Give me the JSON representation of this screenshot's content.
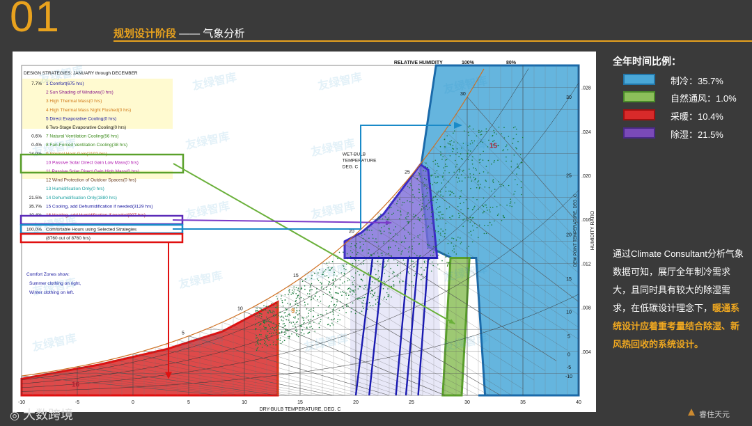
{
  "header": {
    "number": "01",
    "title": "规划设计阶段",
    "subtitle": " —— 气象分析"
  },
  "legend": {
    "title": "全年时间比例：",
    "items": [
      {
        "label": "制冷：35.7%",
        "fill": "#4aa8d8",
        "border": "#2277aa"
      },
      {
        "label": "自然通风：1.0%",
        "fill": "#8cbf5a",
        "border": "#4a8a2a"
      },
      {
        "label": "采暖：10.4%",
        "fill": "#d82a2a",
        "border": "#a01010"
      },
      {
        "label": "除湿：21.5%",
        "fill": "#7a4ab8",
        "border": "#4a2a88"
      }
    ]
  },
  "description": {
    "normal": "通过Climate Consultant分析气象数据可知，展厅全年制冷需求大，且同时具有较大的除湿需求，在低碳设计理念下，",
    "highlight": "暖通系统设计应着重考量结合除湿、新风热回收的系统设计。"
  },
  "footer": {
    "left": "大数跨境",
    "right": "睿住天元"
  },
  "watermark": "友绿智库",
  "chart_data": {
    "type": "scatter",
    "header": "DESIGN STRATEGIES:  JANUARY through DECEMBER",
    "strategies": [
      {
        "pct": "7.7%",
        "text": "1  Comfort(675 hrs)",
        "color": "#1a1aa0"
      },
      {
        "pct": "",
        "text": "2  Sun Shading of Windows(0 hrs)",
        "color": "#8a1a8a"
      },
      {
        "pct": "",
        "text": "3  High Thermal Mass(0 hrs)",
        "color": "#d07a1a"
      },
      {
        "pct": "",
        "text": "4  High Thermal Mass Night Flushed(0 hrs)",
        "color": "#d07a1a"
      },
      {
        "pct": "",
        "text": "5  Direct Evaporative Cooling(0 hrs)",
        "color": "#1a1aa0"
      },
      {
        "pct": "",
        "text": "6  Two-Stage Evaporative Cooling(0 hrs)",
        "color": "#1a1a1a"
      },
      {
        "pct": "0.6%",
        "text": "7  Natural Ventilation Cooling(56 hrs)",
        "color": "#3a8a1a"
      },
      {
        "pct": "0.4%",
        "text": "8  Fan-Forced Ventilation Cooling(38 hrs)",
        "color": "#3a8a1a"
      },
      {
        "pct": "24.0%",
        "text": "9  Internal Heat Gain(2102 hrs)",
        "color": "#d07a1a"
      },
      {
        "pct": "",
        "text": "10  Passive Solar Direct Gain Low Mass(0 hrs)",
        "color": "#b01ab0"
      },
      {
        "pct": "",
        "text": "11  Passive Solar Direct Gain High Mass(0 hrs)",
        "color": "#b01ab0"
      },
      {
        "pct": "",
        "text": "12  Wind Protection of Outdoor Spaces(0 hrs)",
        "color": "#6a3a1a"
      },
      {
        "pct": "",
        "text": "13  Humidification Only(0 hrs)",
        "color": "#1aa0a0"
      },
      {
        "pct": "21.5%",
        "text": "14  Dehumidification Only(1880 hrs)",
        "color": "#1aa0a0"
      },
      {
        "pct": "35.7%",
        "text": "15  Cooling, add Dehumidification if needed(3129 hrs)",
        "color": "#1a1aa0"
      },
      {
        "pct": "10.4%",
        "text": "16  Heating, add Humidification if needed(907 hrs)",
        "color": "#c01a1a"
      },
      {
        "pct": "100.0%",
        "text": "Comfortable Hours using Selected Strategies",
        "color": "#1a1a1a"
      },
      {
        "pct": "",
        "text": "(8760 out of 8760 hrs)",
        "color": "#1a1a1a"
      }
    ],
    "comfort_zones": [
      "Comfort Zones show:",
      "Summer clothing on right,",
      "Winter clothing on left."
    ],
    "xlabel": "DRY-BULB TEMPERATURE, DEG. C",
    "ylabel_right": "HUMIDITY RATIO",
    "ylabel_dewpoint": "DEW POINT TEMPERATURE, DEG. C",
    "wetbulb_label": [
      "WET-BULB",
      "TEMPERATURE",
      "DEG. C"
    ],
    "rh_label": "RELATIVE HUMIDITY",
    "rh_ticks": [
      "100%",
      "80%"
    ],
    "x_ticks": [
      -10,
      -5,
      0,
      5,
      10,
      15,
      20,
      25,
      30,
      35,
      40
    ],
    "xlim": [
      -10,
      40
    ],
    "hr_ticks": [
      ".004",
      ".008",
      ".012",
      ".016",
      ".020",
      ".024",
      ".028"
    ],
    "dew_ticks": [
      "-10",
      "-5",
      "0",
      "5",
      "10",
      "15",
      "20",
      "25",
      "30"
    ],
    "wetbulb_ticks": [
      "5",
      "10",
      "15",
      "20",
      "25",
      "30"
    ],
    "ylim": [
      0,
      0.03
    ],
    "zone_labels": [
      "15",
      "16",
      "9",
      "7"
    ]
  }
}
